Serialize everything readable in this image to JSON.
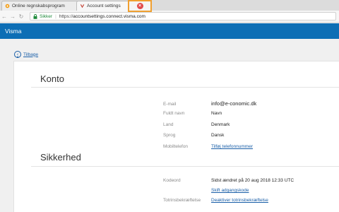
{
  "browser": {
    "tabs": [
      {
        "title": "Online regnskabsprogram",
        "active": false
      },
      {
        "title": "Account settings",
        "active": true
      }
    ],
    "address": {
      "secure_label": "Sikker",
      "url_scheme": "https://",
      "url_host": "accountsettings.connect.visma.com"
    }
  },
  "app": {
    "brand": "Visma"
  },
  "nav": {
    "back_label": "Tilbage"
  },
  "konto": {
    "title": "Konto",
    "rows": [
      {
        "label": "E-mail",
        "value": "info@e-conomic.dk"
      },
      {
        "label": "Fuldt navn",
        "value": "Navn"
      },
      {
        "label": "Land",
        "value": "Denmark"
      },
      {
        "label": "Sprog",
        "value": "Dansk"
      },
      {
        "label": "Mobiltelefon",
        "value": "Tilføj telefonnummer"
      }
    ]
  },
  "sikkerhed": {
    "title": "Sikkerhed",
    "password_label": "Kodeord",
    "password_value": "Sidst ændret på 20 aug 2018 12:33 UTC",
    "change_password_link": "Skift adgangskode",
    "twofa_label": "Totrinsbekræftelse",
    "twofa_link": "Deaktiver totrinsbekræftelse"
  },
  "colors": {
    "brand_blue": "#0d6eb5",
    "link_blue": "#1a5fa8",
    "highlight_orange": "#f0a030",
    "secure_green": "#1e8a3a"
  }
}
